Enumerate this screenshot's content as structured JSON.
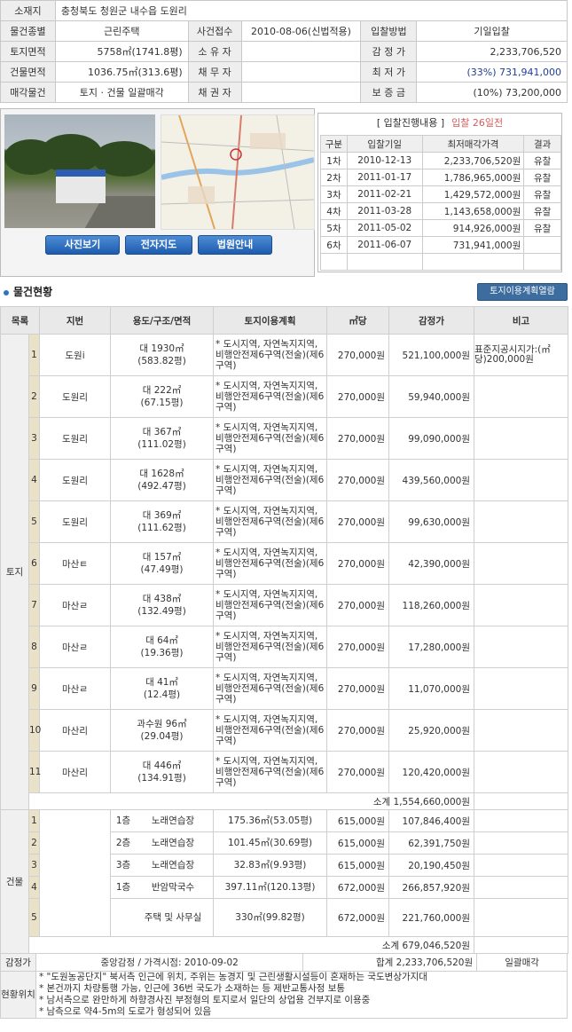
{
  "info": {
    "rows": [
      [
        {
          "t": "소재지",
          "lb": true
        },
        {
          "t": "충청북도 청원군 내수읍 도원리",
          "span": 7,
          "l": true
        }
      ],
      [
        {
          "t": "물건종별",
          "lb": true
        },
        {
          "t": "근린주택"
        },
        {
          "t": "사건접수",
          "lb": true
        },
        {
          "t": "2010-08-06(신법적용)",
          "span": 2
        },
        {
          "t": "입찰방법",
          "lb": true
        },
        {
          "t": "기일입찰",
          "span": 2
        }
      ],
      [
        {
          "t": "토지면적",
          "lb": true
        },
        {
          "t": "5758㎡(1741.8평)",
          "r": true
        },
        {
          "t": "소 유 자",
          "lb": true
        },
        {
          "t": "",
          "span": 2
        },
        {
          "t": "감 정 가",
          "lb": true
        },
        {
          "t": "2,233,706,520",
          "span": 2,
          "r": true
        }
      ],
      [
        {
          "t": "건물면적",
          "lb": true
        },
        {
          "t": "1036.75㎡(313.6평)",
          "r": true
        },
        {
          "t": "채 무 자",
          "lb": true
        },
        {
          "t": "",
          "span": 2
        },
        {
          "t": "최 저 가",
          "lb": true
        },
        {
          "t": "(33%) 731,941,000",
          "span": 2,
          "r": true,
          "blue": true
        }
      ],
      [
        {
          "t": "매각물건",
          "lb": true
        },
        {
          "t": "토지 · 건물 일괄매각"
        },
        {
          "t": "채 권 자",
          "lb": true
        },
        {
          "t": "",
          "span": 2
        },
        {
          "t": "보 증 금",
          "lb": true
        },
        {
          "t": "(10%) 73,200,000",
          "span": 2,
          "r": true
        }
      ]
    ]
  },
  "buttons": {
    "photo": "사진보기",
    "map": "전자지도",
    "court": "법원안내"
  },
  "history": {
    "title": "[ 입찰진행내용 ]",
    "subtitle": "입찰 26일전",
    "headers": [
      "구분",
      "입찰기일",
      "최저매각가격",
      "결과"
    ],
    "rows": [
      [
        "1차",
        "2010-12-13",
        "2,233,706,520원",
        "유찰"
      ],
      [
        "2차",
        "2011-01-17",
        "1,786,965,000원",
        "유찰"
      ],
      [
        "3차",
        "2011-02-21",
        "1,429,572,000원",
        "유찰"
      ],
      [
        "4차",
        "2011-03-28",
        "1,143,658,000원",
        "유찰"
      ],
      [
        "5차",
        "2011-05-02",
        "914,926,000원",
        "유찰"
      ],
      [
        "6차",
        "2011-06-07",
        "731,941,000원",
        ""
      ]
    ]
  },
  "section": {
    "title": "물건현황",
    "land_plan_button": "토지이용계획열람"
  },
  "prop": {
    "headers": [
      "목록",
      "지번",
      "용도/구조/면적",
      "토지이용계획",
      "㎡당",
      "감정가",
      "비고"
    ],
    "land_label": "토지",
    "building_label": "건물",
    "plan_text": "* 도시지역, 자연녹지지역, 비행안전제6구역(전술)(제6구역)",
    "land": [
      {
        "no": "1",
        "jibun": "도원i",
        "use": "대 1930㎡",
        "area": "(583.82평)",
        "unit": "270,000원",
        "appr": "521,100,000원",
        "note": "표준지공시지가:(㎡당)200,000원"
      },
      {
        "no": "2",
        "jibun": "도원리",
        "use": "대 222㎡",
        "area": "(67.15평)",
        "unit": "270,000원",
        "appr": "59,940,000원",
        "note": ""
      },
      {
        "no": "3",
        "jibun": "도원리",
        "use": "대 367㎡",
        "area": "(111.02평)",
        "unit": "270,000원",
        "appr": "99,090,000원",
        "note": ""
      },
      {
        "no": "4",
        "jibun": "도원리",
        "use": "대 1628㎡",
        "area": "(492.47평)",
        "unit": "270,000원",
        "appr": "439,560,000원",
        "note": ""
      },
      {
        "no": "5",
        "jibun": "도원리",
        "use": "대 369㎡",
        "area": "(111.62평)",
        "unit": "270,000원",
        "appr": "99,630,000원",
        "note": ""
      },
      {
        "no": "6",
        "jibun": "마산ㅌ",
        "use": "대 157㎡",
        "area": "(47.49평)",
        "unit": "270,000원",
        "appr": "42,390,000원",
        "note": ""
      },
      {
        "no": "7",
        "jibun": "마산ㄹ",
        "use": "대 438㎡",
        "area": "(132.49평)",
        "unit": "270,000원",
        "appr": "118,260,000원",
        "note": ""
      },
      {
        "no": "8",
        "jibun": "마산ㄹ",
        "use": "대 64㎡",
        "area": "(19.36평)",
        "unit": "270,000원",
        "appr": "17,280,000원",
        "note": ""
      },
      {
        "no": "9",
        "jibun": "마산ㄹ",
        "use": "대 41㎡",
        "area": "(12.4평)",
        "unit": "270,000원",
        "appr": "11,070,000원",
        "note": ""
      },
      {
        "no": "10",
        "jibun": "마산리",
        "use": "과수원 96㎡",
        "area": "(29.04평)",
        "unit": "270,000원",
        "appr": "25,920,000원",
        "note": ""
      },
      {
        "no": "11",
        "jibun": "마산리",
        "use": "대 446㎡",
        "area": "(134.91평)",
        "unit": "270,000원",
        "appr": "120,420,000원",
        "note": ""
      }
    ],
    "land_subtotal": "소계 1,554,660,000원",
    "building": [
      {
        "no": "1",
        "floor": "1층",
        "use": "노래연습장",
        "area": "175.36㎡(53.05평)",
        "unit": "615,000원",
        "appr": "107,846,400원"
      },
      {
        "no": "2",
        "floor": "2층",
        "use": "노래연습장",
        "area": "101.45㎡(30.69평)",
        "unit": "615,000원",
        "appr": "62,391,750원"
      },
      {
        "no": "3",
        "floor": "3층",
        "use": "노래연습장",
        "area": "32.83㎡(9.93평)",
        "unit": "615,000원",
        "appr": "20,190,450원"
      },
      {
        "no": "4",
        "floor": "1층",
        "use": "반암막국수",
        "area": "397.11㎡(120.13평)",
        "unit": "672,000원",
        "appr": "266,857,920원"
      },
      {
        "no": "5",
        "floor": "",
        "use": "주택 및 사무실",
        "area": "330㎡(99.82평)",
        "unit": "672,000원",
        "appr": "221,760,000원"
      }
    ],
    "building_subtotal": "소계 679,046,520원"
  },
  "bottom": {
    "appraisal_label": "감정가",
    "appraisal_text": "중앙감정 / 가격시점: 2010-09-02",
    "total": "합계 2,233,706,520원",
    "sale_type": "일괄매각",
    "location_label": "현황위치",
    "location_lines": [
      "* \"도원농공단지\" 북서측 인근에 위치, 주위는 농경지 및 근린생활시설등이 혼재하는 국도변상가지대",
      "* 본건까지 차량통행 가능, 인근에 36번 국도가 소재하는 등 제반교통사정 보통",
      "* 남서측으로 완만하게 하향경사진 부정형의 토지로서 일단의 상업용 건부지로 이용중",
      "* 남측으로 약4-5m의 도로가 형성되어 있음"
    ]
  }
}
